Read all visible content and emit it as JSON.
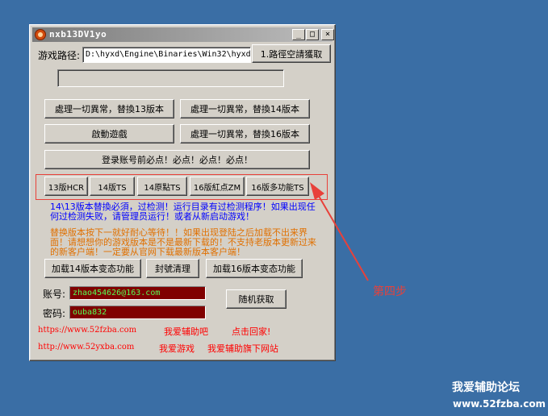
{
  "window": {
    "title": "nxb13DV1yo",
    "min_label": "_",
    "max_label": "□",
    "close_label": "×"
  },
  "path": {
    "label": "游戏路径:",
    "value": "D:\\hyxd\\Engine\\Binaries\\Win32\\hyxd",
    "button": "1.路徑空請獲取"
  },
  "buttons": {
    "handle13": "處理一切異常，替換13版本",
    "handle14": "處理一切異常，替換14版本",
    "start_game": "啟動遊戲",
    "handle16": "處理一切異常，替換16版本",
    "login_note": "登录账号前必点！必点！必点！必点！"
  },
  "versions": [
    {
      "label": "13版HCR"
    },
    {
      "label": "14版TS"
    },
    {
      "label": "14原點TS"
    },
    {
      "label": "16版紅点ZM"
    },
    {
      "label": "16版多功能TS"
    }
  ],
  "notes": {
    "blue": "14\\13版本替換必須，过检测！运行目录有过检测程序！如果出现任何过检测失败，请管理员运行！或者从新启动游戏！",
    "orange": "替换版本按下一就好耐心等待！！如果出现登陆之后加载不出来界面！请想想你的游戏版本是不是最新下载的！不支持老版本更新过来的新客户端！一定要从官网下载最新版本客户端！",
    "blue_color": "#0000ff",
    "orange_color": "#e07000"
  },
  "actions": {
    "load14": "加载14版本变态功能",
    "seal_clean": "封號清理",
    "load16": "加载16版本变态功能"
  },
  "account": {
    "user_label": "账号:",
    "user_value": "zhao454626@163.com",
    "pass_label": "密码:",
    "pass_value": "ouba832",
    "random_button": "随机获取"
  },
  "links": {
    "url1": "https://www.52fzba.com",
    "text1a": "我爱辅助吧",
    "text1b": "点击回家!",
    "url2": "http://www.52yxba.com",
    "text2a": "我爱游戏",
    "text2b": "我爱辅助旗下网站"
  },
  "annotation": {
    "step": "第四步",
    "color": "#e8413a"
  },
  "watermark": {
    "line1": "我爱辅助论坛",
    "line2": "www.52fzba.com"
  }
}
